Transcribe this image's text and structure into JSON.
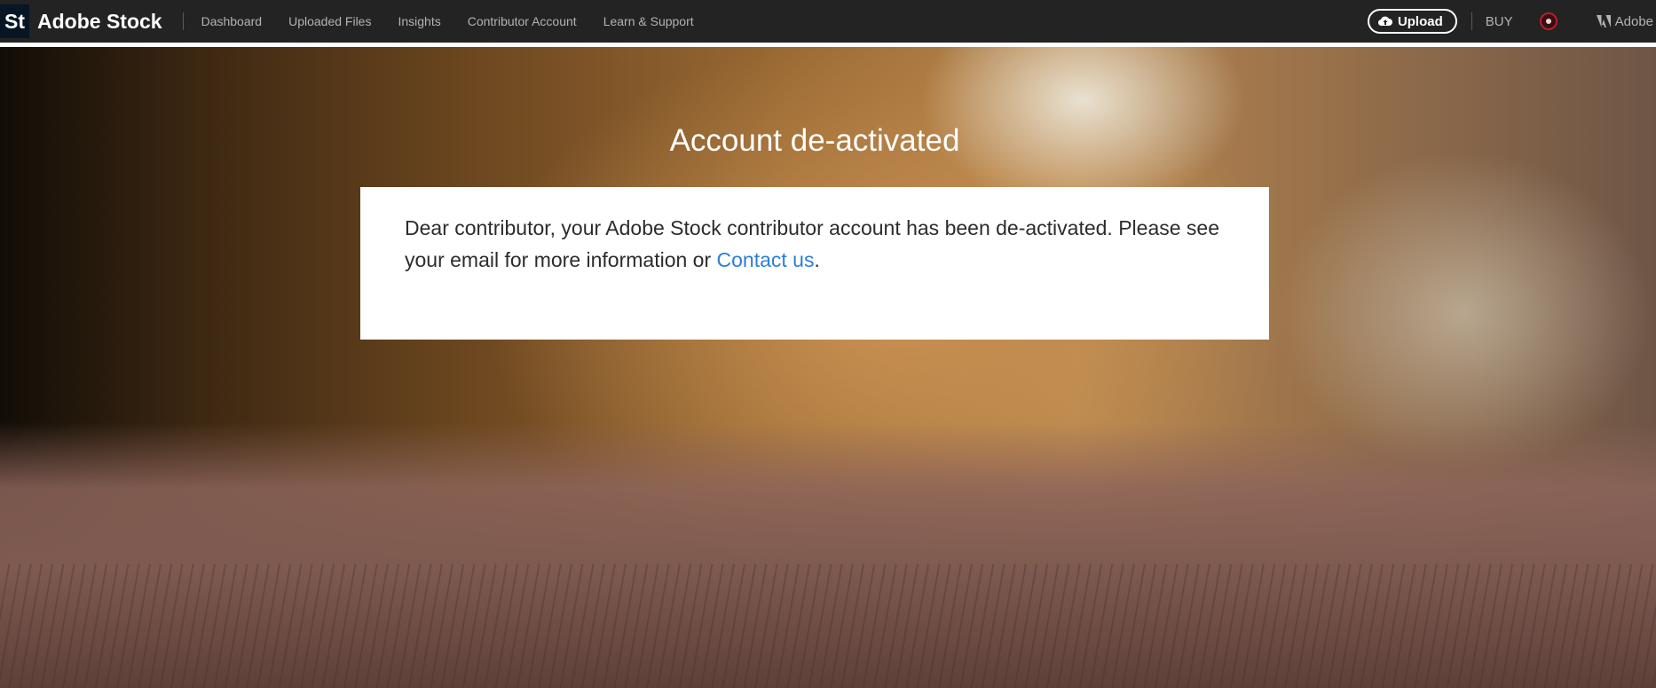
{
  "header": {
    "logo_text": "St",
    "brand": "Adobe Stock",
    "nav": [
      {
        "label": "Dashboard"
      },
      {
        "label": "Uploaded Files"
      },
      {
        "label": "Insights"
      },
      {
        "label": "Contributor Account"
      },
      {
        "label": "Learn & Support"
      }
    ],
    "upload_label": "Upload",
    "buy_label": "BUY",
    "adobe_label": "Adobe",
    "colors": {
      "background": "#232323",
      "text": "#b3b3b3"
    }
  },
  "main": {
    "title": "Account de-activated",
    "message_before": "Dear contributor, your Adobe Stock contributor account has been de-activated. Please see your email for more information or ",
    "link_text": "Contact us",
    "message_after": ".",
    "link_color": "#2d7fd6"
  },
  "icons": {
    "upload": "cloud-upload-icon",
    "avatar": "user-avatar-icon",
    "adobe": "adobe-logo-icon"
  }
}
